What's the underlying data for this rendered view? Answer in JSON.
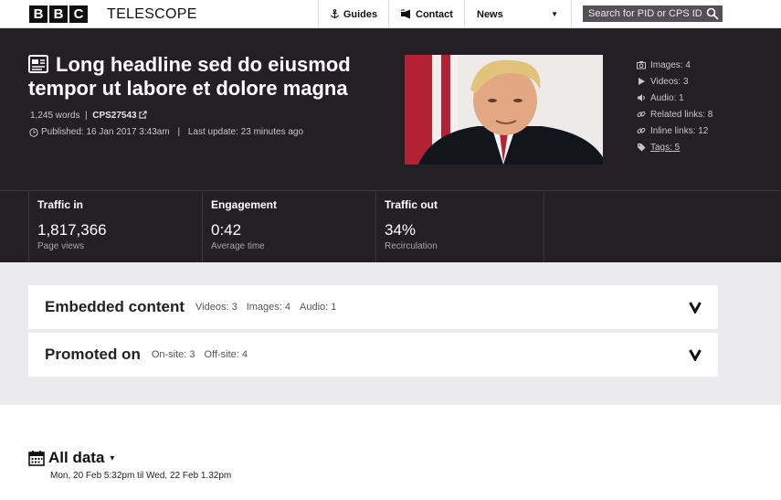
{
  "app": {
    "logo_letters": [
      "B",
      "B",
      "C"
    ],
    "title": "TELESCOPE"
  },
  "nav": {
    "guides": "Guides",
    "contact": "Contact",
    "news": "News",
    "search_placeholder": "Search for PID or CPS ID"
  },
  "article": {
    "headline": "Long headline sed do eiusmod tempor ut labore et dolore magna",
    "word_count": "1,245 words",
    "separator": "|",
    "cps_id": "CPS27543",
    "published": "Published: 16 Jan 2017 3:43am",
    "last_update": "Last update: 23 minutes ago"
  },
  "assets": [
    {
      "icon": "camera-icon",
      "label": "Images: 4"
    },
    {
      "icon": "play-icon",
      "label": "Videos: 3"
    },
    {
      "icon": "speaker-icon",
      "label": "Audio: 1"
    },
    {
      "icon": "link-icon",
      "label": "Related links: 8"
    },
    {
      "icon": "link-icon",
      "label": "Inline links: 12"
    },
    {
      "icon": "tag-icon",
      "label": "Tags: 5"
    }
  ],
  "metrics": [
    {
      "title": "Traffic in",
      "value": "1,817,366",
      "sub": "Page views"
    },
    {
      "title": "Engagement",
      "value": "0:42",
      "sub": "Average time"
    },
    {
      "title": "Traffic out",
      "value": "34%",
      "sub": "Recirculation"
    }
  ],
  "embedded": {
    "title": "Embedded content",
    "items": [
      "Videos: 3",
      "Images: 4",
      "Audio: 1"
    ]
  },
  "promoted": {
    "title": "Promoted on",
    "items": [
      "On-site: 3",
      "Off-site: 4"
    ]
  },
  "all_data": {
    "title": "All data",
    "range": "Mon, 20 Feb 5:32pm til Wed, 22 Feb 1.32pm"
  },
  "colors": {
    "hero_bg": "#231f24",
    "panel_bg": "#ebebed",
    "search_bg": "#555058"
  }
}
